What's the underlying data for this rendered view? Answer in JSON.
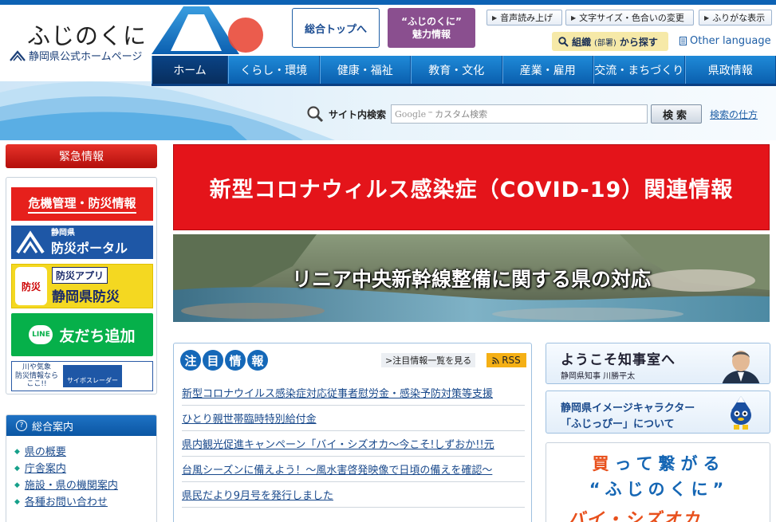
{
  "header": {
    "logo_title": "ふじのくに",
    "logo_subtitle": "静岡県公式ホームページ",
    "top_button": "総合トップへ",
    "miryoku_line1": "“ふじのくに”",
    "miryoku_line2": "魅力情報",
    "util_links": [
      "音声読み上げ",
      "文字サイズ・色合いの変更",
      "ふりがな表示"
    ],
    "soshiki_main": "組織",
    "soshiki_small": "(部署)",
    "soshiki_tail": "から探す",
    "other_language": "Other language"
  },
  "nav": {
    "items": [
      "ホーム",
      "くらし・環境",
      "健康・福祉",
      "教育・文化",
      "産業・雇用",
      "交流・まちづくり",
      "県政情報"
    ]
  },
  "search": {
    "label": "サイト内検索",
    "placeholder_brand": "Google",
    "placeholder_tm": "™",
    "placeholder": "カスタム検索",
    "button": "検索",
    "help": "検索の仕方"
  },
  "left": {
    "emergency": "緊急情報",
    "kiki": "危機管理・防災情報",
    "portal_small1": "静岡県",
    "portal_big": "防災ポータル",
    "app_icon": "防災",
    "app_label": "防災アプリ",
    "app_name": "静岡県防災",
    "line_icon": "LINE",
    "line_label": "友だち追加",
    "sabo_text1": "川や気象",
    "sabo_text2": "防災情報なら",
    "sabo_text3": "ここ!!",
    "sabo_badge": "サイボスレーダー",
    "sogo_title": "総合案内",
    "sogo_icon": "?",
    "sogo_items": [
      "県の概要",
      "庁舎案内",
      "施設・県の機関案内",
      "各種お問い合わせ"
    ]
  },
  "main": {
    "covid_banner": "新型コロナウィルス感染症（COVID-19）関連情報",
    "linear_banner": "リニア中央新幹線整備に関する県の対応",
    "news_title_chars": [
      "注",
      "目",
      "情",
      "報"
    ],
    "news_all": ">注目情報一覧を見る",
    "rss": "RSS",
    "news_items": [
      "新型コロナウイルス感染症対応従事者慰労金・感染予防対策等支援",
      "ひとり親世帯臨時特別給付金",
      "県内観光促進キャンペーン「バイ・シズオカ〜今こそ!しずおか!!元",
      "台風シーズンに備えよう！〜風水害啓発映像で日頃の備えを確認〜",
      "県民だより9月号を発行しました"
    ]
  },
  "right": {
    "chiji_title": "ようこそ知事室へ",
    "chiji_sub": "静岡県知事 川勝平太",
    "chara_line1": "静岡県イメージキャラクター",
    "chara_line2": "「ふじっぴー」について",
    "buy_first": "買",
    "buy_rest": "って繋がる",
    "buy_line2": "“ふじのくに”",
    "buy_line3": "バイ・シズオカ"
  },
  "colors": {
    "nav_blue": "#0a5fae",
    "covid_red": "#e4141a",
    "miryoku_purple": "#8a4f8f",
    "line_green": "#06b04a"
  }
}
